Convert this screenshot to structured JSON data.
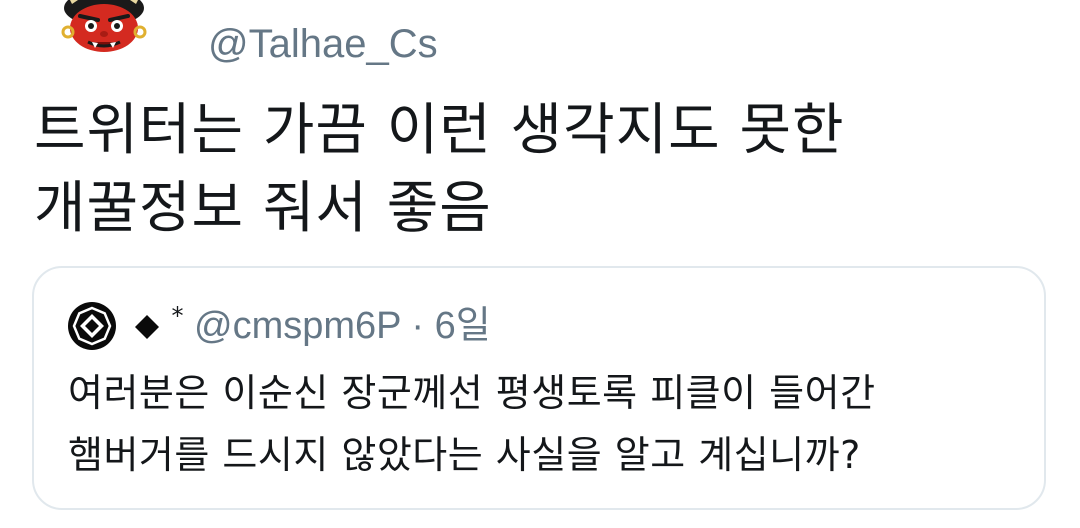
{
  "tweet": {
    "avatar_icon": "red-oni-mask-icon",
    "handle": "@Talhae_Cs",
    "text_lines": [
      "트위터는 가끔 이런 생각지도 못한",
      "개꿀정보 줘서 좋음"
    ]
  },
  "quoted_tweet": {
    "avatar_icon": "octagon-emblem-icon",
    "name_icon": "black-diamond-icon",
    "name_mark": "*",
    "handle": "@cmspm6P",
    "separator": "·",
    "time": "6일",
    "text_lines": [
      "여러분은 이순신 장군께선 평생토록 피클이 들어간",
      "햄버거를 드시지 않았다는 사실을 알고 계십니까?"
    ]
  },
  "colors": {
    "text": "#14171a",
    "secondary_text": "#657786",
    "border": "#e1e8ed",
    "avatar_red": "#d42a20"
  }
}
